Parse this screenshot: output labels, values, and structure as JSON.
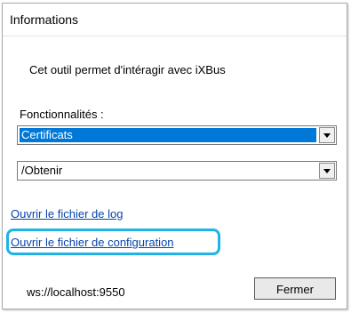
{
  "window": {
    "title": "Informations"
  },
  "description": "Cet outil permet d'intéragir avec iXBus",
  "features": {
    "label": "Fonctionnalités :",
    "selected_feature": "Certificats",
    "selected_action": "/Obtenir"
  },
  "links": {
    "log": "Ouvrir le fichier de log",
    "config": "Ouvrir le fichier de configuration"
  },
  "footer": {
    "ws_url": "ws://localhost:9550",
    "close_label": "Fermer"
  },
  "colors": {
    "selection": "#0078d7",
    "link": "#0645ad",
    "highlight": "#1fb3e8"
  },
  "icons": {
    "dropdown": "chevron-down-icon"
  }
}
